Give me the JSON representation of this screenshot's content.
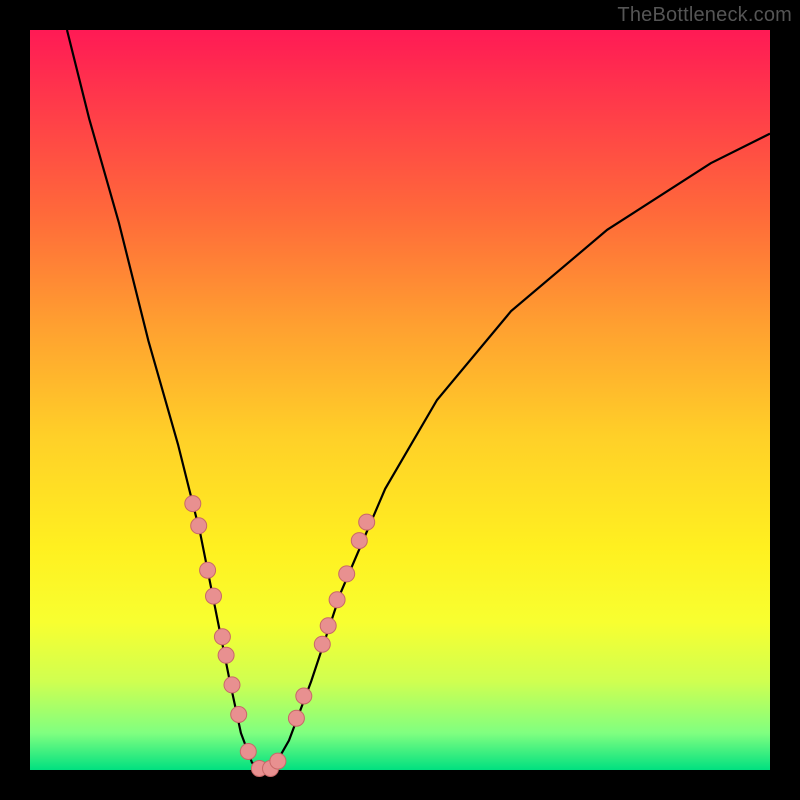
{
  "watermark": "TheBottleneck.com",
  "colors": {
    "curve": "#000000",
    "dot_fill": "#e89090",
    "dot_stroke": "#c86868"
  },
  "chart_data": {
    "type": "line",
    "title": "",
    "xlabel": "",
    "ylabel": "",
    "xlim": [
      0,
      100
    ],
    "ylim": [
      0,
      100
    ],
    "series": [
      {
        "name": "curve",
        "x": [
          5,
          8,
          12,
          16,
          20,
          23,
          25,
          27,
          28.5,
          30,
          31.5,
          33,
          35,
          38,
          42,
          48,
          55,
          65,
          78,
          92,
          100
        ],
        "y": [
          100,
          88,
          74,
          58,
          44,
          32,
          22,
          12,
          5,
          1,
          0,
          0.5,
          4,
          12,
          24,
          38,
          50,
          62,
          73,
          82,
          86
        ]
      }
    ],
    "points": [
      {
        "x": 22.0,
        "y": 36.0
      },
      {
        "x": 22.8,
        "y": 33.0
      },
      {
        "x": 24.0,
        "y": 27.0
      },
      {
        "x": 24.8,
        "y": 23.5
      },
      {
        "x": 26.0,
        "y": 18.0
      },
      {
        "x": 26.5,
        "y": 15.5
      },
      {
        "x": 27.3,
        "y": 11.5
      },
      {
        "x": 28.2,
        "y": 7.5
      },
      {
        "x": 29.5,
        "y": 2.5
      },
      {
        "x": 31.0,
        "y": 0.2
      },
      {
        "x": 32.5,
        "y": 0.2
      },
      {
        "x": 33.5,
        "y": 1.2
      },
      {
        "x": 36.0,
        "y": 7.0
      },
      {
        "x": 37.0,
        "y": 10.0
      },
      {
        "x": 39.5,
        "y": 17.0
      },
      {
        "x": 40.3,
        "y": 19.5
      },
      {
        "x": 41.5,
        "y": 23.0
      },
      {
        "x": 42.8,
        "y": 26.5
      },
      {
        "x": 44.5,
        "y": 31.0
      },
      {
        "x": 45.5,
        "y": 33.5
      }
    ],
    "dot_radius": 8
  }
}
